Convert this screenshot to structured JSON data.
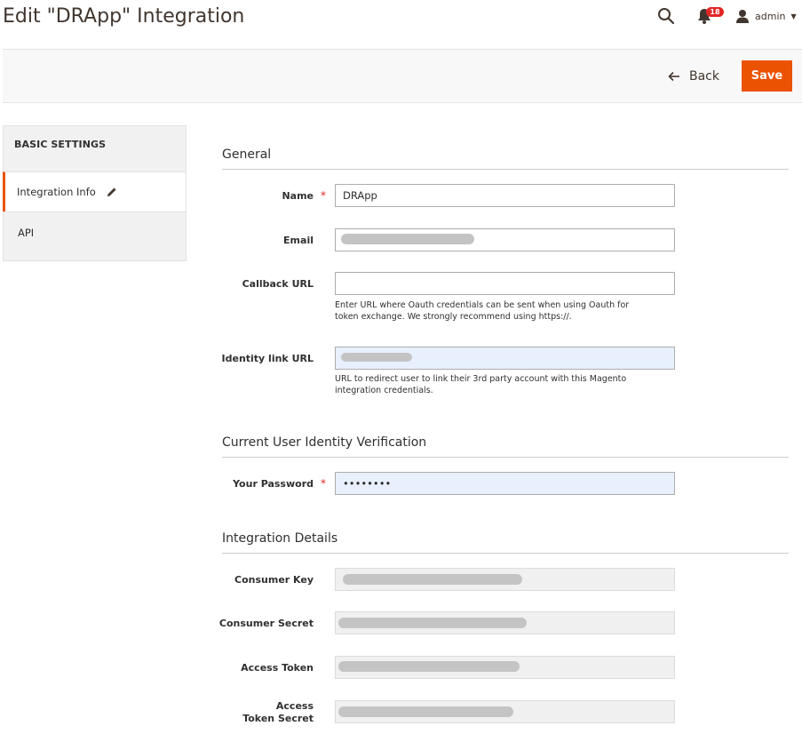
{
  "header": {
    "title": "Edit \"DRApp\" Integration",
    "notifications_count": "18",
    "user_name": "admin"
  },
  "actions": {
    "back_label": "Back",
    "save_label": "Save"
  },
  "sidebar": {
    "heading": "BASIC SETTINGS",
    "items": [
      {
        "label": "Integration Info",
        "active": true
      },
      {
        "label": "API",
        "active": false
      }
    ]
  },
  "general": {
    "title": "General",
    "name_label": "Name",
    "name_value": "DRApp",
    "email_label": "Email",
    "callback_label": "Callback URL",
    "callback_note": "Enter URL where Oauth credentials can be sent when using Oauth for token exchange. We strongly recommend using https://.",
    "identity_label": "Identity link URL",
    "identity_note": "URL to redirect user to link their 3rd party account with this Magento integration credentials."
  },
  "verification": {
    "title": "Current User Identity Verification",
    "password_label": "Your Password",
    "password_value": "••••••••"
  },
  "details": {
    "title": "Integration Details",
    "consumer_key_label": "Consumer Key",
    "consumer_secret_label": "Consumer Secret",
    "access_token_label": "Access Token",
    "access_token_secret_label": "Access Token Secret"
  },
  "colors": {
    "accent": "#eb5202",
    "required": "#e22626",
    "autofill": "#e8f0fe"
  }
}
